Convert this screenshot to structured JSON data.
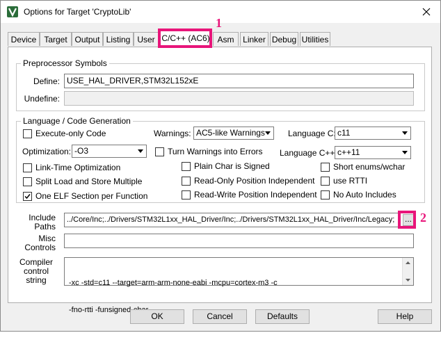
{
  "window": {
    "title": "Options for Target 'CryptoLib'"
  },
  "tabs": [
    {
      "label": "Device"
    },
    {
      "label": "Target"
    },
    {
      "label": "Output"
    },
    {
      "label": "Listing"
    },
    {
      "label": "User"
    },
    {
      "label": "C/C++ (AC6)"
    },
    {
      "label": "Asm"
    },
    {
      "label": "Linker"
    },
    {
      "label": "Debug"
    },
    {
      "label": "Utilities"
    }
  ],
  "markers": {
    "one": "1",
    "two": "2"
  },
  "preprocessor": {
    "legend": "Preprocessor Symbols",
    "define_label": "Define:",
    "define_value": "USE_HAL_DRIVER,STM32L152xE",
    "undefine_label": "Undefine:",
    "undefine_value": ""
  },
  "language": {
    "legend": "Language / Code Generation",
    "execute_only": {
      "label": "Execute-only Code",
      "checked": false
    },
    "warnings_label": "Warnings:",
    "warnings_value": "AC5-like Warnings",
    "language_c_label": "Language C:",
    "language_c_value": "c11",
    "optimization_label": "Optimization:",
    "optimization_value": "-O3",
    "turn_warnings": {
      "label": "Turn Warnings into Errors",
      "checked": false
    },
    "language_cpp_label": "Language C++:",
    "language_cpp_value": "c++11",
    "link_time": {
      "label": "Link-Time Optimization",
      "checked": false
    },
    "plain_char": {
      "label": "Plain Char is Signed",
      "checked": false
    },
    "short_enums": {
      "label": "Short enums/wchar",
      "checked": false
    },
    "split_load": {
      "label": "Split Load and Store Multiple",
      "checked": false
    },
    "read_only": {
      "label": "Read-Only Position Independent",
      "checked": false
    },
    "use_rtti": {
      "label": "use RTTI",
      "checked": false
    },
    "one_elf": {
      "label": "One ELF Section per Function",
      "checked": true
    },
    "read_write": {
      "label": "Read-Write Position Independent",
      "checked": false
    },
    "no_auto": {
      "label": "No Auto Includes",
      "checked": false
    }
  },
  "include": {
    "label_line1": "Include",
    "label_line2": "Paths",
    "value": "../Core/Inc;../Drivers/STM32L1xx_HAL_Driver/Inc;../Drivers/STM32L1xx_HAL_Driver/Inc/Legacy;",
    "browse_label": "..."
  },
  "misc": {
    "label_line1": "Misc",
    "label_line2": "Controls",
    "value": ""
  },
  "compiler": {
    "label_line1": "Compiler",
    "label_line2": "control",
    "label_line3": "string",
    "line1": "-xc -std=c11 --target=arm-arm-none-eabi -mcpu=cortex-m3 -c",
    "line2": "-fno-rtti -funsigned-char"
  },
  "buttons": {
    "ok": "OK",
    "cancel": "Cancel",
    "defaults": "Defaults",
    "help": "Help"
  },
  "colors": {
    "highlight": "#e8157a",
    "app_icon": "#2b6d3a"
  }
}
